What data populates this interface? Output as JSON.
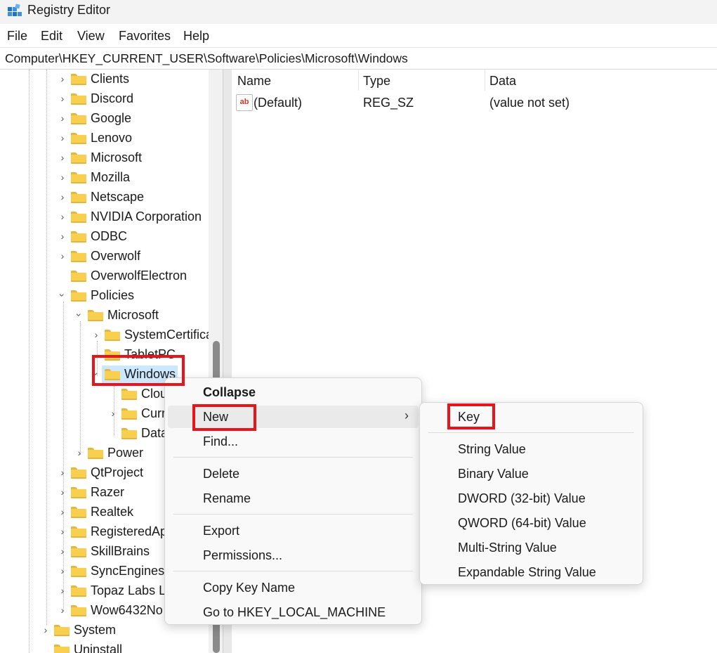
{
  "window": {
    "title": "Registry Editor"
  },
  "menubar": {
    "file": "File",
    "edit": "Edit",
    "view": "View",
    "favorites": "Favorites",
    "help": "Help"
  },
  "address": {
    "path": "Computer\\HKEY_CURRENT_USER\\Software\\Policies\\Microsoft\\Windows"
  },
  "tree": {
    "clients": "Clients",
    "discord": "Discord",
    "google": "Google",
    "lenovo": "Lenovo",
    "microsoft": "Microsoft",
    "mozilla": "Mozilla",
    "netscape": "Netscape",
    "nvidia": "NVIDIA Corporation",
    "odbc": "ODBC",
    "overwolf": "Overwolf",
    "overwolfelectron": "OverwolfElectron",
    "policies": "Policies",
    "policies_microsoft": "Microsoft",
    "systemcertificates": "SystemCertifica",
    "tabletpc": "TabletPC",
    "windows": "Windows",
    "cloud": "Clou",
    "current": "Curr",
    "data": "Data",
    "power": "Power",
    "qtproject": "QtProject",
    "razer": "Razer",
    "realtek": "Realtek",
    "registeredapps": "RegisteredAp",
    "skillbrains": "SkillBrains",
    "syncengines": "SyncEngines",
    "topaz": "Topaz Labs Ll",
    "wow6432": "Wow6432No",
    "system": "System",
    "uninstall": "Uninstall"
  },
  "values": {
    "headers": {
      "name": "Name",
      "type": "Type",
      "data": "Data"
    },
    "rows": [
      {
        "name": "(Default)",
        "type": "REG_SZ",
        "data": "(value not set)",
        "icon": "string-value-icon"
      }
    ]
  },
  "context_menu": {
    "collapse": "Collapse",
    "new": "New",
    "find": "Find...",
    "delete": "Delete",
    "rename": "Rename",
    "export": "Export",
    "permissions": "Permissions...",
    "copy_key_name": "Copy Key Name",
    "goto_hklm": "Go to HKEY_LOCAL_MACHINE"
  },
  "submenu": {
    "key": "Key",
    "string_value": "String Value",
    "binary_value": "Binary Value",
    "dword_value": "DWORD (32-bit) Value",
    "qword_value": "QWORD (64-bit) Value",
    "multi_string_value": "Multi-String Value",
    "expandable_string_value": "Expandable String Value"
  },
  "colors": {
    "highlight_border": "#e8131b",
    "folder": "#f8cf4e",
    "selection": "#cce8ff"
  }
}
